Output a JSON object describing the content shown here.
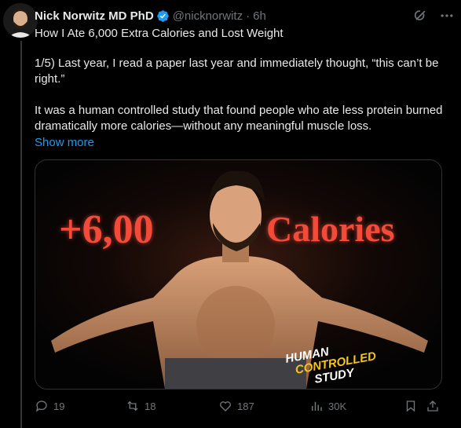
{
  "author": {
    "name": "Nick Norwitz MD PhD",
    "handle": "@nicknorwitz",
    "time": "6h",
    "verified_color": "#1d9bf0"
  },
  "tweet": {
    "title": "How I Ate 6,000 Extra Calories and Lost Weight",
    "para1": "1/5) Last year, I read a paper last year and immediately thought, “this can’t be right.”",
    "para2": "It was a human controlled study that found people who ate less protein burned dramatically more calories—without any meaningful muscle loss.",
    "show_more": "Show more"
  },
  "media": {
    "headline_left": "+6,00",
    "headline_right": "Calories",
    "badge_line1": "HUMAN",
    "badge_line2": "CONTROLLED",
    "badge_line3": "STUDY",
    "headline_color": "#f24b3a",
    "badge_accent": "#f5c518"
  },
  "actions": {
    "replies": "19",
    "reposts": "18",
    "likes": "187",
    "views": "30K"
  },
  "icons": [
    "grok-icon",
    "more-icon",
    "reply-icon",
    "repost-icon",
    "like-icon",
    "views-icon",
    "bookmark-icon",
    "share-icon"
  ]
}
